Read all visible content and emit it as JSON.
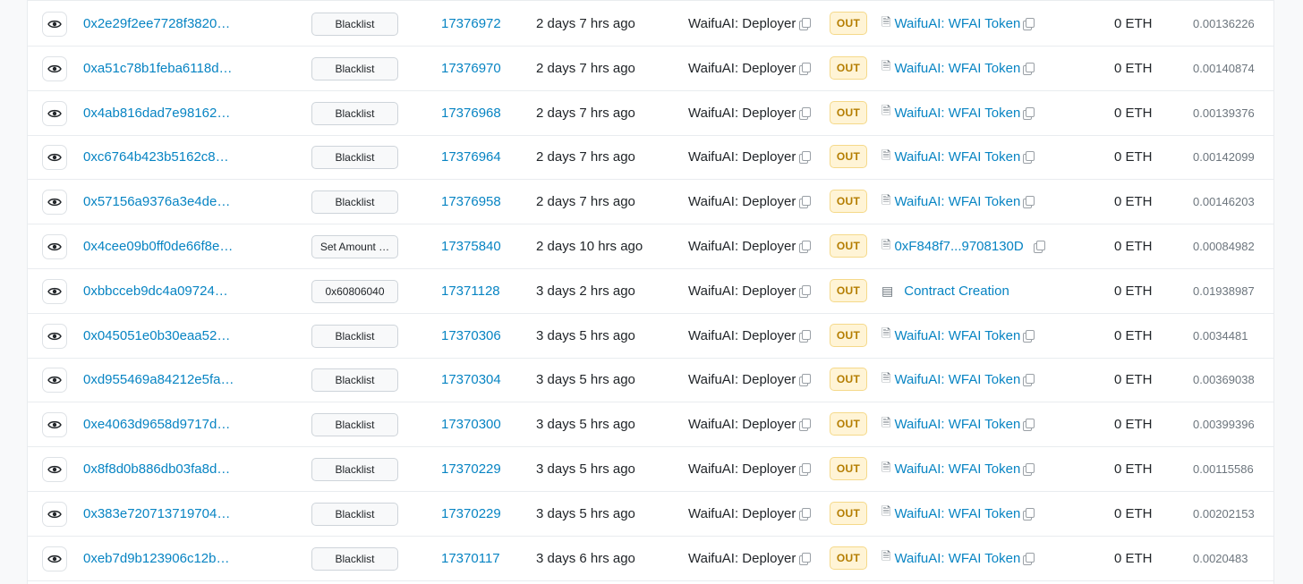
{
  "rows": [
    {
      "hash": "0x2e29f2ee7728f3820…",
      "method": "Blacklist",
      "block": "17376972",
      "age": "2 days 7 hrs ago",
      "from": "WaifuAI: Deployer",
      "dir": "OUT",
      "to": "WaifuAI: WFAI Token",
      "to_type": "token",
      "value": "0 ETH",
      "fee": "0.00136226"
    },
    {
      "hash": "0xa51c78b1feba6118d…",
      "method": "Blacklist",
      "block": "17376970",
      "age": "2 days 7 hrs ago",
      "from": "WaifuAI: Deployer",
      "dir": "OUT",
      "to": "WaifuAI: WFAI Token",
      "to_type": "token",
      "value": "0 ETH",
      "fee": "0.00140874"
    },
    {
      "hash": "0x4ab816dad7e98162…",
      "method": "Blacklist",
      "block": "17376968",
      "age": "2 days 7 hrs ago",
      "from": "WaifuAI: Deployer",
      "dir": "OUT",
      "to": "WaifuAI: WFAI Token",
      "to_type": "token",
      "value": "0 ETH",
      "fee": "0.00139376"
    },
    {
      "hash": "0xc6764b423b5162c8…",
      "method": "Blacklist",
      "block": "17376964",
      "age": "2 days 7 hrs ago",
      "from": "WaifuAI: Deployer",
      "dir": "OUT",
      "to": "WaifuAI: WFAI Token",
      "to_type": "token",
      "value": "0 ETH",
      "fee": "0.00142099"
    },
    {
      "hash": "0x57156a9376a3e4de…",
      "method": "Blacklist",
      "block": "17376958",
      "age": "2 days 7 hrs ago",
      "from": "WaifuAI: Deployer",
      "dir": "OUT",
      "to": "WaifuAI: WFAI Token",
      "to_type": "token",
      "value": "0 ETH",
      "fee": "0.00146203"
    },
    {
      "hash": "0x4cee09b0ff0de66f8e…",
      "method": "Set Amount …",
      "block": "17375840",
      "age": "2 days 10 hrs ago",
      "from": "WaifuAI: Deployer",
      "dir": "OUT",
      "to": "0xF848f7...9708130D",
      "to_type": "address",
      "value": "0 ETH",
      "fee": "0.00084982"
    },
    {
      "hash": "0xbbcceb9dc4a09724…",
      "method": "0x60806040",
      "block": "17371128",
      "age": "3 days 2 hrs ago",
      "from": "WaifuAI: Deployer",
      "dir": "OUT",
      "to": "Contract Creation",
      "to_type": "creation",
      "value": "0 ETH",
      "fee": "0.01938987"
    },
    {
      "hash": "0x045051e0b30eaa52…",
      "method": "Blacklist",
      "block": "17370306",
      "age": "3 days 5 hrs ago",
      "from": "WaifuAI: Deployer",
      "dir": "OUT",
      "to": "WaifuAI: WFAI Token",
      "to_type": "token",
      "value": "0 ETH",
      "fee": "0.0034481"
    },
    {
      "hash": "0xd955469a84212e5fa…",
      "method": "Blacklist",
      "block": "17370304",
      "age": "3 days 5 hrs ago",
      "from": "WaifuAI: Deployer",
      "dir": "OUT",
      "to": "WaifuAI: WFAI Token",
      "to_type": "token",
      "value": "0 ETH",
      "fee": "0.00369038"
    },
    {
      "hash": "0xe4063d9658d9717d…",
      "method": "Blacklist",
      "block": "17370300",
      "age": "3 days 5 hrs ago",
      "from": "WaifuAI: Deployer",
      "dir": "OUT",
      "to": "WaifuAI: WFAI Token",
      "to_type": "token",
      "value": "0 ETH",
      "fee": "0.00399396"
    },
    {
      "hash": "0x8f8d0b886db03fa8d…",
      "method": "Blacklist",
      "block": "17370229",
      "age": "3 days 5 hrs ago",
      "from": "WaifuAI: Deployer",
      "dir": "OUT",
      "to": "WaifuAI: WFAI Token",
      "to_type": "token",
      "value": "0 ETH",
      "fee": "0.00115586"
    },
    {
      "hash": "0x383e720713719704…",
      "method": "Blacklist",
      "block": "17370229",
      "age": "3 days 5 hrs ago",
      "from": "WaifuAI: Deployer",
      "dir": "OUT",
      "to": "WaifuAI: WFAI Token",
      "to_type": "token",
      "value": "0 ETH",
      "fee": "0.00202153"
    },
    {
      "hash": "0xeb7d9b123906c12b…",
      "method": "Blacklist",
      "block": "17370117",
      "age": "3 days 6 hrs ago",
      "from": "WaifuAI: Deployer",
      "dir": "OUT",
      "to": "WaifuAI: WFAI Token",
      "to_type": "token",
      "value": "0 ETH",
      "fee": "0.0020483"
    }
  ],
  "colors": {
    "link": "#0784c3",
    "out_badge_bg": "#fff4d6",
    "out_badge_text": "#b47d00"
  },
  "icons": {
    "view": "eye-icon",
    "copy": "copy-icon",
    "token": "document-icon",
    "creation": "contract-creation-icon"
  }
}
